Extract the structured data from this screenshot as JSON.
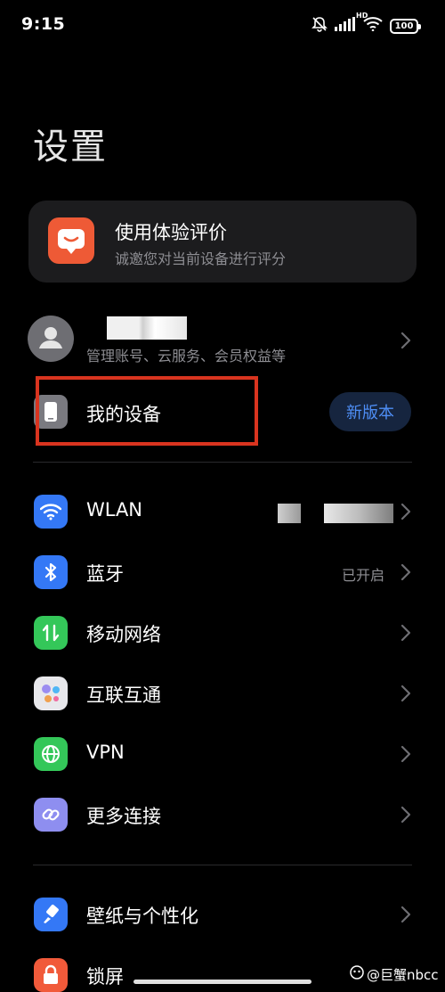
{
  "status_bar": {
    "time": "9:15",
    "network_label": "HD",
    "battery": "100"
  },
  "page": {
    "title": "设置"
  },
  "feedback": {
    "title": "使用体验评价",
    "subtitle": "诚邀您对当前设备进行评分"
  },
  "account": {
    "subtitle": "管理账号、云服务、会员权益等"
  },
  "my_device": {
    "label": "我的设备",
    "badge": "新版本"
  },
  "connectivity": [
    {
      "label": "WLAN",
      "value": "",
      "icon": "wifi-icon",
      "color": "#3478f6"
    },
    {
      "label": "蓝牙",
      "value": "已开启",
      "icon": "bluetooth-icon",
      "color": "#3478f6"
    },
    {
      "label": "移动网络",
      "value": "",
      "icon": "mobile-data-icon",
      "color": "#34c759"
    },
    {
      "label": "互联互通",
      "value": "",
      "icon": "interconnect-icon",
      "color": "#e8e8ec"
    },
    {
      "label": "VPN",
      "value": "",
      "icon": "globe-icon",
      "color": "#34c759"
    },
    {
      "label": "更多连接",
      "value": "",
      "icon": "link-icon",
      "color": "#8e8ef0"
    }
  ],
  "personalization": [
    {
      "label": "壁纸与个性化",
      "icon": "brush-icon",
      "color": "#3478f6"
    },
    {
      "label": "锁屏",
      "icon": "lock-icon",
      "color": "#f15a3a"
    }
  ],
  "watermark": {
    "text": "@巨蟹nbcc"
  },
  "colors": {
    "accent": "#4e8ef5",
    "highlight": "#d9341f",
    "card": "#1c1c1e"
  }
}
